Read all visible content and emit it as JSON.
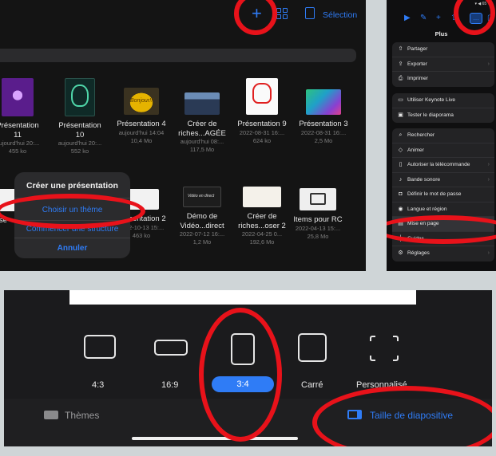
{
  "browser": {
    "toolbar": {
      "selection_label": "Sélection"
    },
    "documents": [
      {
        "name": "Présentation\n11",
        "meta": "aujourd'hui 20:...\n455 ko"
      },
      {
        "name": "Présentation\n10",
        "meta": "aujourd'hui 20:...\n552 ko"
      },
      {
        "name": "Présentation 4",
        "meta": "aujourd'hui 14:04\n10,4 Mo"
      },
      {
        "name": "Créer de\nriches...AGÉE",
        "meta": "aujourd'hui 08:...\n117,5 Mo"
      },
      {
        "name": "Présentation 9",
        "meta": "2022-08-31 16:...\n624 ko"
      },
      {
        "name": "Présentation 3",
        "meta": "2022-08-31 16:...\n2,5 Mo"
      },
      {
        "name": "se",
        "meta": ""
      },
      {
        "name": "Présentation 2",
        "meta": "2022-10-13 15:...\n463 ko"
      },
      {
        "name": "Démo de\nVidéo...direct",
        "meta": "2022-07-12 16:...\n1,2 Mo"
      },
      {
        "name": "Créer de\nriches...oser 2",
        "meta": "2022-04-25 0...\n192,6 Mo"
      },
      {
        "name": "Items pour RC",
        "meta": "2022-04-13 15:...\n25,8 Mo"
      }
    ],
    "thumb_captions": {
      "gold": "Bonjour!!!",
      "dark": "Vidéo en direct"
    },
    "popup": {
      "title": "Créer une présentation",
      "choose_theme": "Choisir un thème",
      "start_outline": "Commencer une structure",
      "cancel": "Annuler"
    }
  },
  "plus_menu": {
    "status": "▾ ◀ 65 %",
    "title": "Plus",
    "groups": [
      [
        {
          "label": "Partager",
          "icon": "share-icon",
          "chevron": false
        },
        {
          "label": "Exporter",
          "icon": "export-icon",
          "chevron": true
        },
        {
          "label": "Imprimer",
          "icon": "print-icon",
          "chevron": false
        }
      ],
      [
        {
          "label": "Utiliser Keynote Live",
          "icon": "keynote-live-icon",
          "chevron": false
        },
        {
          "label": "Tester le diaporama",
          "icon": "rehearse-icon",
          "chevron": false
        }
      ],
      [
        {
          "label": "Rechercher",
          "icon": "search-icon",
          "chevron": false
        },
        {
          "label": "Animer",
          "icon": "animate-icon",
          "chevron": false
        },
        {
          "label": "Autoriser la télécommande",
          "icon": "remote-icon",
          "chevron": true
        },
        {
          "label": "Bande sonore",
          "icon": "music-icon",
          "chevron": true
        },
        {
          "label": "Définir le mot de passe",
          "icon": "lock-icon",
          "chevron": false
        },
        {
          "label": "Langue et région",
          "icon": "globe-icon",
          "chevron": false
        },
        {
          "label": "Mise en page",
          "icon": "layout-icon",
          "chevron": false
        },
        {
          "label": "Guides",
          "icon": "guides-icon",
          "chevron": false
        },
        {
          "label": "Réglages",
          "icon": "settings-icon",
          "chevron": true
        }
      ]
    ]
  },
  "slide_size": {
    "options": [
      {
        "label": "4:3",
        "selected": false
      },
      {
        "label": "16:9",
        "selected": false
      },
      {
        "label": "3:4",
        "selected": true
      },
      {
        "label": "Carré",
        "selected": false
      },
      {
        "label": "Personnalisé",
        "selected": false
      }
    ],
    "tabs": {
      "themes": "Thèmes",
      "slide_size": "Taille de diapositive"
    }
  },
  "colors": {
    "accent": "#2f7cf6",
    "annotation": "#e8121a"
  }
}
